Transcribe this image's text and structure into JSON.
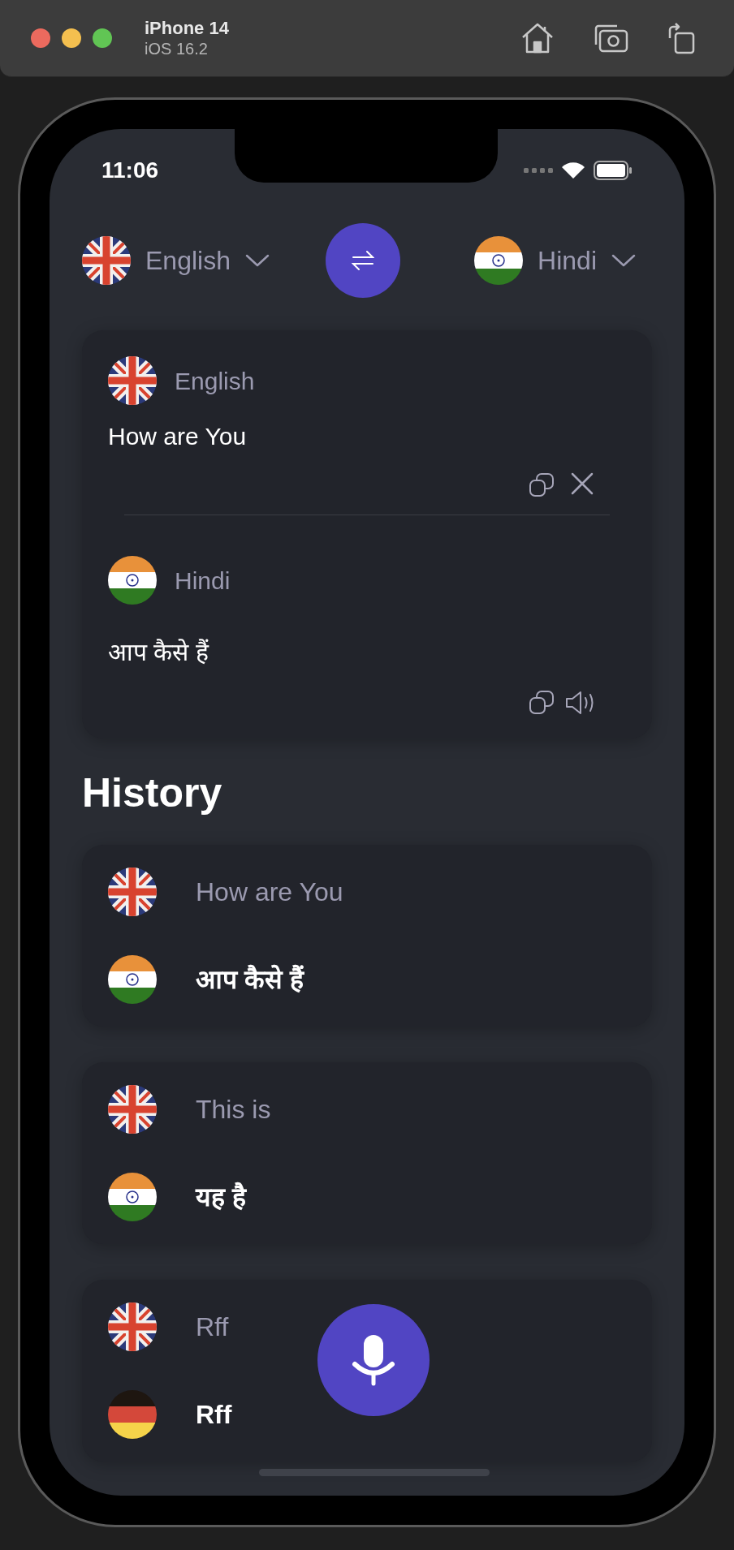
{
  "simulator": {
    "device": "iPhone 14",
    "os": "iOS 16.2"
  },
  "status_bar": {
    "time": "11:06"
  },
  "language_bar": {
    "source": {
      "kind": "uk",
      "label": "English"
    },
    "target": {
      "kind": "in",
      "label": "Hindi"
    }
  },
  "translator": {
    "input": {
      "kind": "uk",
      "language": "English",
      "text": "How are You"
    },
    "output": {
      "kind": "in",
      "language": "Hindi",
      "text": "आप कैसे हैं"
    }
  },
  "history": {
    "title": "History",
    "items": [
      {
        "source": {
          "kind": "uk",
          "text": "How are You"
        },
        "target": {
          "kind": "in",
          "text": "आप कैसे हैं"
        }
      },
      {
        "source": {
          "kind": "uk",
          "text": "This is"
        },
        "target": {
          "kind": "in",
          "text": "यह है"
        }
      },
      {
        "source": {
          "kind": "uk",
          "text": "Rff"
        },
        "target": {
          "kind": "de",
          "text": "Rff"
        }
      }
    ]
  }
}
